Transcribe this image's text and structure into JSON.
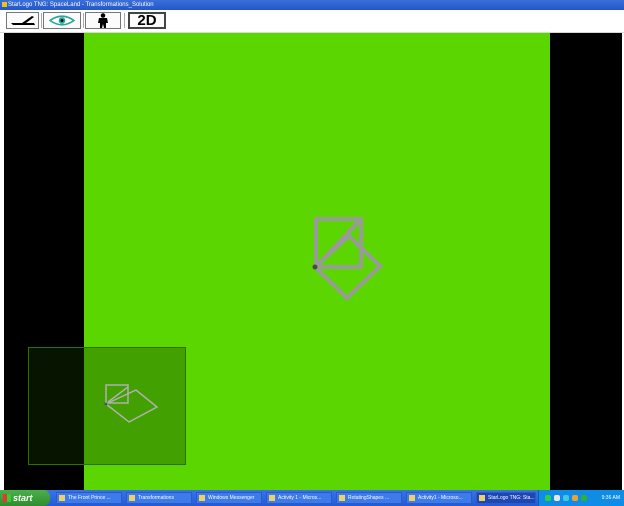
{
  "window": {
    "title": "StarLogo TNG: SpaceLand - Transformations_Solution"
  },
  "toolbar": {
    "buttons": [
      {
        "name": "aerial-view",
        "icon": "airplane-icon"
      },
      {
        "name": "eye-view",
        "icon": "eye-icon"
      },
      {
        "name": "agent-view",
        "icon": "person-icon"
      },
      {
        "name": "2d-view",
        "label": "2D"
      }
    ]
  },
  "spaceland": {
    "background": "#000000",
    "terrain_color": "#5bd600",
    "agent_color": "#9a9a9a"
  },
  "taskbar": {
    "start_label": "start",
    "tasks": [
      "The Front Prince ...",
      "Transformations",
      "Windows Messenger",
      "Activity 1 - Micros...",
      "RotatingShapes ...",
      "Activity1 - Microso...",
      "StarLogo TNG: Sta..."
    ],
    "clock": "9:36 AM"
  }
}
